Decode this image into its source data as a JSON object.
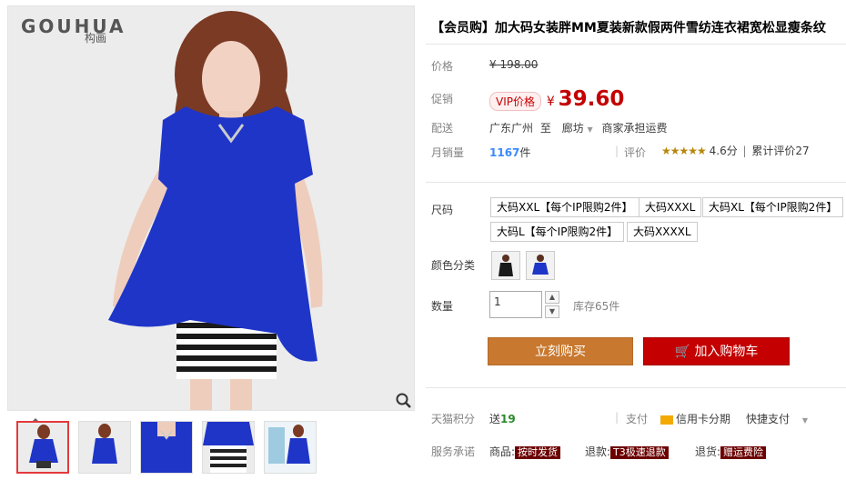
{
  "brand": {
    "logo": "GOUHUA",
    "logo_sub": "构画"
  },
  "product": {
    "title": "【会员购】加大码女装胖MM夏装新款假两件雪纺连衣裙宽松显瘦条纹",
    "price_label": "价格",
    "original_price": "¥ 198.00",
    "promo_label": "促销",
    "vip_badge": "VIP价格",
    "currency": "¥",
    "promo_price": "39.60",
    "shipping_label": "配送",
    "ship_from": "广东广州",
    "ship_to_word": "至",
    "ship_to": "廊坊",
    "ship_fee": "商家承担运费",
    "sales_label": "月销量",
    "sales_count": "1167",
    "sales_unit": "件",
    "review_label": "评价",
    "rating": "4.6分",
    "rating_value": 4.6,
    "review_count_label": "累计评价27"
  },
  "options": {
    "size_label": "尺码",
    "sizes": [
      "大码XXL【每个IP限购2件】",
      "大码XXXL",
      "大码XL【每个IP限购2件】",
      "大码L【每个IP限购2件】",
      "大码XXXXL"
    ],
    "color_label": "颜色分类",
    "colors": [
      "black-dress-swatch",
      "blue-dress-swatch"
    ],
    "qty_label": "数量",
    "qty_value": "1",
    "stock": "库存65件"
  },
  "actions": {
    "buy_now": "立刻购买",
    "add_cart": "加入购物车"
  },
  "extras": {
    "points_label": "天猫积分",
    "points_text": "送",
    "points_value": "19",
    "pay_label": "支付",
    "credit": "信用卡分期",
    "quick_pay": "快捷支付",
    "service_label": "服务承诺",
    "goods_label": "商品:",
    "goods_tag": "按时发货",
    "refund_label": "退款:",
    "refund_tag": "T3极速退款",
    "return_label": "退货:",
    "return_tag": "赠运费险"
  },
  "colors": {
    "price_red": "#c40000",
    "buy_orange": "#c8782f",
    "cart_red": "#c40000",
    "dress_blue": "#1f35c8"
  }
}
